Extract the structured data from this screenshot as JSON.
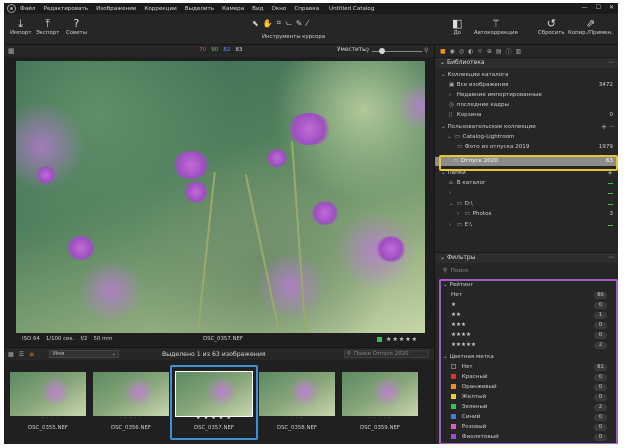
{
  "app": {
    "window_title": "Untitled Catalog",
    "menu": [
      "Файл",
      "Редактировать",
      "Изображение",
      "Коррекции",
      "Выделить",
      "Камера",
      "Вид",
      "Окно",
      "Справка"
    ]
  },
  "toolbar": {
    "import_label": "Импорт",
    "export_label": "Экспорт",
    "tips_label": "Советы",
    "cursor_tools_label": "Инструменты курсора",
    "done_label": "До",
    "autocorrect_label": "Автокоррекция",
    "reset_label": "Сбросить",
    "copy_apply_label": "Копир./Примен."
  },
  "viewer_bar": {
    "hist_r": "70",
    "hist_g": "90",
    "hist_b": "82",
    "hist_w": "83",
    "fit_label": "Уместить"
  },
  "photo_info": {
    "iso": "ISO 64",
    "shutter": "1/100 сек.",
    "aperture": "f/2",
    "focal": "50 mm",
    "filename": "DSC_0357.NEF"
  },
  "strip": {
    "sort_value": "Имя",
    "selection_label": "Выделено 1 из 63 изображения",
    "search_placeholder": "Поиск Отпуск 2020",
    "thumbs": [
      {
        "name": "DSC_0355.NEF"
      },
      {
        "name": "DSC_0356.NEF"
      },
      {
        "name": "DSC_0357.NEF"
      },
      {
        "name": "DSC_0358.NEF"
      },
      {
        "name": "DSC_0359.NEF"
      }
    ]
  },
  "library": {
    "title": "Библиотека",
    "catalog_collections": "Коллекции каталога",
    "all_images": "Все изображения",
    "all_images_count": "3472",
    "recent_imports": "Недавние импортированные",
    "recent_captures": "последние кадры",
    "trash": "Корзина",
    "trash_count": "0",
    "user_collections": "Пользовательские коллекции",
    "catalog_lightroom": "Catalog-Lightroom",
    "vacation_2019": "Фото из отпуска 2019",
    "vacation_2019_count": "1979",
    "vacation_2020": "Отпуск 2020",
    "vacation_2020_count": "63",
    "folders": "Папки",
    "in_catalog": "В каталог",
    "drive_d": "D:\\",
    "photos": "Photos",
    "photos_count": "3",
    "drive_e": "E:\\"
  },
  "filters": {
    "title": "Фильтры",
    "search_placeholder": "Поиск",
    "rating_title": "Рейтинг",
    "rating_rows": [
      {
        "label": "Нет",
        "count": "60"
      },
      {
        "label": "★",
        "count": "0"
      },
      {
        "label": "★★",
        "count": "1"
      },
      {
        "label": "★★★",
        "count": "0"
      },
      {
        "label": "★★★★",
        "count": "0"
      },
      {
        "label": "★★★★★",
        "count": "2"
      }
    ],
    "color_title": "Цветная метка",
    "color_rows": [
      {
        "label": "Нет",
        "count": "61",
        "color": "#2b2b2b"
      },
      {
        "label": "Красный",
        "count": "0",
        "color": "#e03232"
      },
      {
        "label": "Оранжевый",
        "count": "0",
        "color": "#e8902a"
      },
      {
        "label": "Желтый",
        "count": "0",
        "color": "#e6d22e"
      },
      {
        "label": "Зеленый",
        "count": "2",
        "color": "#36c252"
      },
      {
        "label": "Синий",
        "count": "0",
        "color": "#3d7fe0"
      },
      {
        "label": "Розовый",
        "count": "0",
        "color": "#e05ac8"
      },
      {
        "label": "Фиолетовый",
        "count": "0",
        "color": "#9a4fd0"
      }
    ]
  },
  "colors": {
    "accent": "#e8902a",
    "highlight_yellow": "#e6c72e",
    "filter_purple": "#a05ec6",
    "selection_blue": "#3d8fd6"
  }
}
